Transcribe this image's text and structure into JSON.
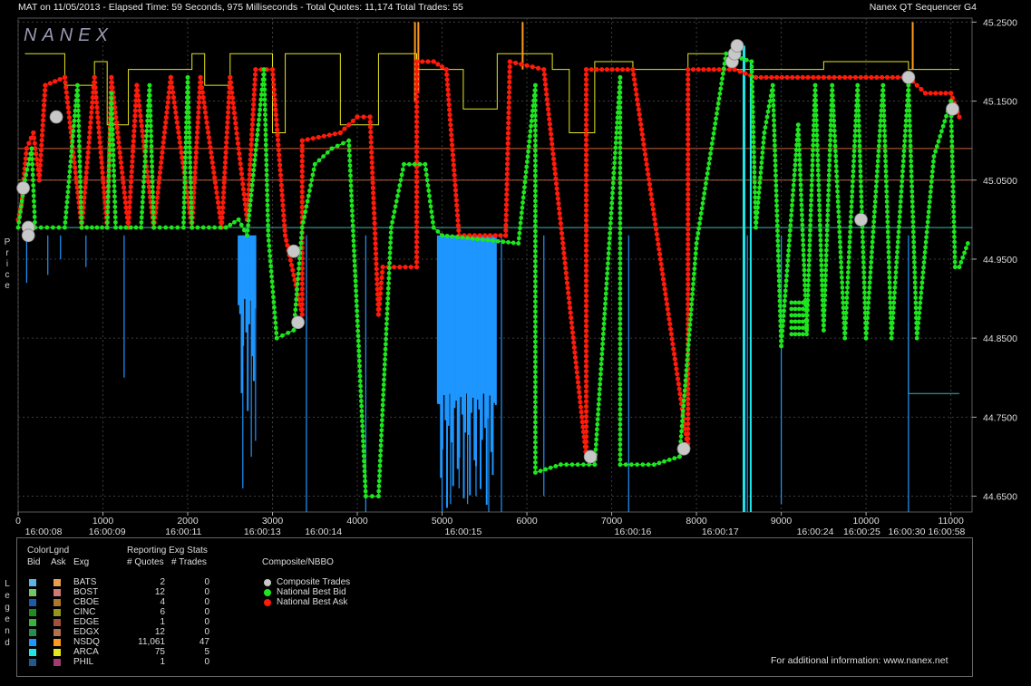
{
  "header": {
    "left": "MAT on 11/05/2013  -  Elapsed Time: 59 Seconds, 975 Milliseconds  -  Total Quotes: 11,174  Total Trades: 55",
    "right": "Nanex QT Sequencer G4"
  },
  "watermark": "NANEX",
  "colors": {
    "bid_green": "#1ee61e",
    "ask_red": "#ff1a0a",
    "trade_gray": "#c8c8c8",
    "nsdq_bid": "#1e96ff",
    "arca_bid": "#20e6e6",
    "yellow_line": "#e6e61e",
    "orange_line": "#ff9a1e"
  },
  "chart_data": {
    "type": "line",
    "ylabel": "Price",
    "ylim": [
      44.63,
      45.255
    ],
    "xlim": [
      0,
      11250
    ],
    "y_ticks": [
      "45.2500",
      "45.1500",
      "45.0500",
      "44.9500",
      "44.8500",
      "44.7500",
      "44.6500"
    ],
    "y_tick_values": [
      45.25,
      45.15,
      45.05,
      44.95,
      44.85,
      44.75,
      44.65
    ],
    "x_ticks": [
      "0",
      "1000",
      "2000",
      "3000",
      "4000",
      "5000",
      "6000",
      "7000",
      "8000",
      "9000",
      "10000",
      "11000"
    ],
    "x_tick_values": [
      0,
      1000,
      2000,
      3000,
      4000,
      5000,
      6000,
      7000,
      8000,
      9000,
      10000,
      11000
    ],
    "time_labels": [
      {
        "x": 300,
        "label": "16:00:08"
      },
      {
        "x": 1050,
        "label": "16:00:09"
      },
      {
        "x": 1950,
        "label": "16:00:11"
      },
      {
        "x": 2880,
        "label": "16:00:13"
      },
      {
        "x": 3600,
        "label": "16:00:14"
      },
      {
        "x": 5250,
        "label": "16:00:15"
      },
      {
        "x": 7250,
        "label": "16:00:16"
      },
      {
        "x": 8280,
        "label": "16:00:17"
      },
      {
        "x": 9400,
        "label": "16:00:24"
      },
      {
        "x": 9950,
        "label": "16:00:25"
      },
      {
        "x": 10480,
        "label": "16:00:30"
      },
      {
        "x": 10950,
        "label": "16:00:58"
      }
    ],
    "series": [
      {
        "name": "National Best Bid",
        "points": [
          [
            0,
            44.99
          ],
          [
            80,
            45.05
          ],
          [
            160,
            45.09
          ],
          [
            200,
            44.99
          ],
          [
            550,
            44.99
          ],
          [
            700,
            45.17
          ],
          [
            750,
            44.99
          ],
          [
            1050,
            44.99
          ],
          [
            1100,
            45.16
          ],
          [
            1150,
            44.99
          ],
          [
            1450,
            44.99
          ],
          [
            1550,
            45.17
          ],
          [
            1600,
            44.99
          ],
          [
            1950,
            44.99
          ],
          [
            2000,
            45.18
          ],
          [
            2050,
            44.99
          ],
          [
            2450,
            44.99
          ],
          [
            2600,
            45.0
          ],
          [
            2700,
            44.98
          ],
          [
            2900,
            45.19
          ],
          [
            2950,
            44.98
          ],
          [
            3050,
            44.85
          ],
          [
            3250,
            44.86
          ],
          [
            3350,
            44.99
          ],
          [
            3500,
            45.07
          ],
          [
            3700,
            45.09
          ],
          [
            3900,
            45.1
          ],
          [
            4100,
            44.65
          ],
          [
            4250,
            44.65
          ],
          [
            4400,
            44.99
          ],
          [
            4550,
            45.07
          ],
          [
            4800,
            45.07
          ],
          [
            4900,
            44.99
          ],
          [
            5000,
            44.98
          ],
          [
            5900,
            44.97
          ],
          [
            6100,
            45.17
          ],
          [
            6100,
            44.68
          ],
          [
            6400,
            44.69
          ],
          [
            6800,
            44.69
          ],
          [
            7100,
            45.18
          ],
          [
            7100,
            44.69
          ],
          [
            7500,
            44.69
          ],
          [
            7800,
            44.7
          ],
          [
            8000,
            44.97
          ],
          [
            8350,
            45.21
          ],
          [
            8650,
            45.2
          ],
          [
            8700,
            44.99
          ],
          [
            8800,
            45.11
          ],
          [
            8900,
            45.17
          ],
          [
            9000,
            44.84
          ],
          [
            9200,
            45.12
          ],
          [
            9300,
            44.86
          ],
          [
            9400,
            45.17
          ],
          [
            9500,
            44.86
          ],
          [
            9600,
            45.17
          ],
          [
            9750,
            44.85
          ],
          [
            9900,
            45.17
          ],
          [
            10000,
            44.85
          ],
          [
            10200,
            45.17
          ],
          [
            10300,
            44.85
          ],
          [
            10500,
            45.17
          ],
          [
            10600,
            44.85
          ],
          [
            10800,
            45.08
          ],
          [
            11000,
            45.15
          ],
          [
            11050,
            44.94
          ],
          [
            11100,
            44.94
          ],
          [
            11200,
            44.97
          ]
        ]
      },
      {
        "name": "National Best Ask",
        "points": [
          [
            0,
            45.0
          ],
          [
            40,
            45.02
          ],
          [
            100,
            45.09
          ],
          [
            180,
            45.11
          ],
          [
            250,
            45.05
          ],
          [
            320,
            45.17
          ],
          [
            550,
            45.18
          ],
          [
            750,
            44.99
          ],
          [
            900,
            45.18
          ],
          [
            1050,
            44.99
          ],
          [
            1100,
            45.18
          ],
          [
            1300,
            44.99
          ],
          [
            1400,
            45.17
          ],
          [
            1600,
            44.99
          ],
          [
            1800,
            45.18
          ],
          [
            2050,
            44.99
          ],
          [
            2150,
            45.18
          ],
          [
            2400,
            44.99
          ],
          [
            2500,
            45.18
          ],
          [
            2700,
            45.0
          ],
          [
            2800,
            45.19
          ],
          [
            3000,
            45.19
          ],
          [
            3150,
            44.98
          ],
          [
            3350,
            44.88
          ],
          [
            3350,
            45.1
          ],
          [
            3800,
            45.11
          ],
          [
            4000,
            45.13
          ],
          [
            4150,
            45.13
          ],
          [
            4250,
            44.88
          ],
          [
            4300,
            44.94
          ],
          [
            4700,
            44.94
          ],
          [
            4700,
            45.2
          ],
          [
            4900,
            45.2
          ],
          [
            5050,
            45.19
          ],
          [
            5200,
            44.98
          ],
          [
            5750,
            44.98
          ],
          [
            5800,
            45.2
          ],
          [
            6200,
            45.19
          ],
          [
            6700,
            44.7
          ],
          [
            6700,
            45.19
          ],
          [
            7250,
            45.19
          ],
          [
            7900,
            44.71
          ],
          [
            7900,
            45.19
          ],
          [
            8450,
            45.19
          ],
          [
            8700,
            45.18
          ],
          [
            9500,
            45.18
          ],
          [
            10000,
            45.18
          ],
          [
            10500,
            45.18
          ],
          [
            10700,
            45.16
          ],
          [
            11000,
            45.16
          ],
          [
            11100,
            45.13
          ]
        ]
      },
      {
        "name": "Composite Trades",
        "points": [
          [
            60,
            45.04
          ],
          [
            120,
            44.99
          ],
          [
            120,
            44.98
          ],
          [
            450,
            45.13
          ],
          [
            3250,
            44.96
          ],
          [
            3300,
            44.87
          ],
          [
            6750,
            44.7
          ],
          [
            7850,
            44.71
          ],
          [
            8420,
            45.2
          ],
          [
            8450,
            45.21
          ],
          [
            8480,
            45.22
          ],
          [
            9940,
            45.0
          ],
          [
            10500,
            45.18
          ],
          [
            11020,
            45.14
          ]
        ]
      }
    ]
  },
  "legend": {
    "side_label": "Legend",
    "headers": {
      "color_legend": "ColorLgnd",
      "bid": "Bid",
      "ask": "Ask",
      "exg": "Exg",
      "stats": "Reporting Exg Stats",
      "quotes": "# Quotes",
      "trades": "# Trades",
      "composite": "Composite/NBBO"
    },
    "rows": [
      {
        "exg": "BATS",
        "quotes": "2",
        "trades": "0",
        "bid_color": "#5ab4e6",
        "ask_color": "#e6a050"
      },
      {
        "exg": "BOST",
        "quotes": "12",
        "trades": "0",
        "bid_color": "#6ec864",
        "ask_color": "#d27878"
      },
      {
        "exg": "CBOE",
        "quotes": "4",
        "trades": "0",
        "bid_color": "#1e5aaa",
        "ask_color": "#aa7828"
      },
      {
        "exg": "CINC",
        "quotes": "6",
        "trades": "0",
        "bid_color": "#1e8c1e",
        "ask_color": "#96961e"
      },
      {
        "exg": "EDGE",
        "quotes": "1",
        "trades": "0",
        "bid_color": "#3cb43c",
        "ask_color": "#a0503c"
      },
      {
        "exg": "EDGX",
        "quotes": "12",
        "trades": "0",
        "bid_color": "#288c50",
        "ask_color": "#b46e50"
      },
      {
        "exg": "NSDQ",
        "quotes": "11,061",
        "trades": "47",
        "bid_color": "#1e96ff",
        "ask_color": "#ff9a1e"
      },
      {
        "exg": "ARCA",
        "quotes": "75",
        "trades": "5",
        "bid_color": "#20e6e6",
        "ask_color": "#e6e61e"
      },
      {
        "exg": "PHIL",
        "quotes": "1",
        "trades": "0",
        "bid_color": "#1e5a8c",
        "ask_color": "#a03c6e"
      }
    ],
    "composite": [
      {
        "label": "Composite Trades",
        "color": "#c8c8c8"
      },
      {
        "label": "National Best Bid",
        "color": "#1ee61e"
      },
      {
        "label": "National Best Ask",
        "color": "#ff1a0a"
      }
    ],
    "footer": "For additional information: www.nanex.net"
  }
}
